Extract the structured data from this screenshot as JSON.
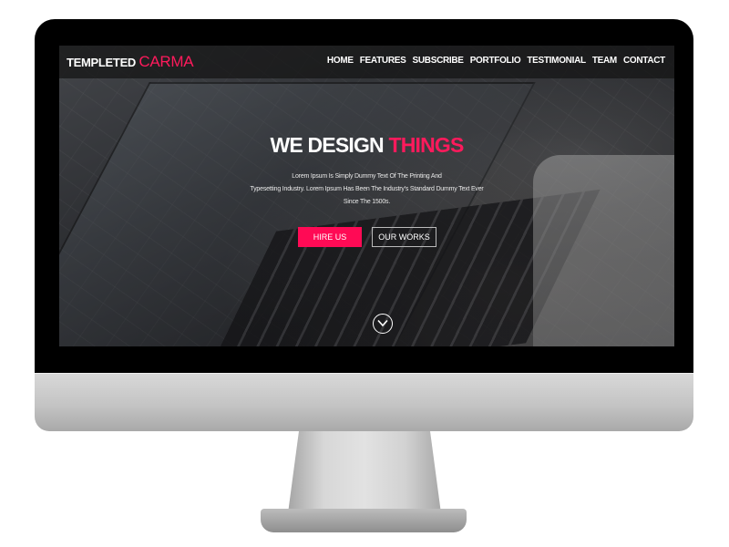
{
  "brand": {
    "prefix": "TEMPLETED",
    "name": "CARMA"
  },
  "nav": [
    "HOME",
    "FEATURES",
    "SUBSCRIBE",
    "PORTFOLIO",
    "TESTIMONIAL",
    "TEAM",
    "CONTACT"
  ],
  "hero": {
    "title_main": "WE DESIGN",
    "title_accent": "THINGS",
    "text_lines": [
      "Lorem Ipsum Is Simply Dummy Text Of The Printing And",
      "Typesetting Industry. Lorem Ipsum Has Been The Industry's Standard Dummy Text Ever",
      "Since The 1500s."
    ],
    "primary_button": "HIRE US",
    "secondary_button": "OUR WORKS"
  },
  "icons": {
    "scroll": "chevron-down-circle-icon"
  },
  "colors": {
    "accent": "#ff1a5c",
    "navbar": "#141414"
  }
}
